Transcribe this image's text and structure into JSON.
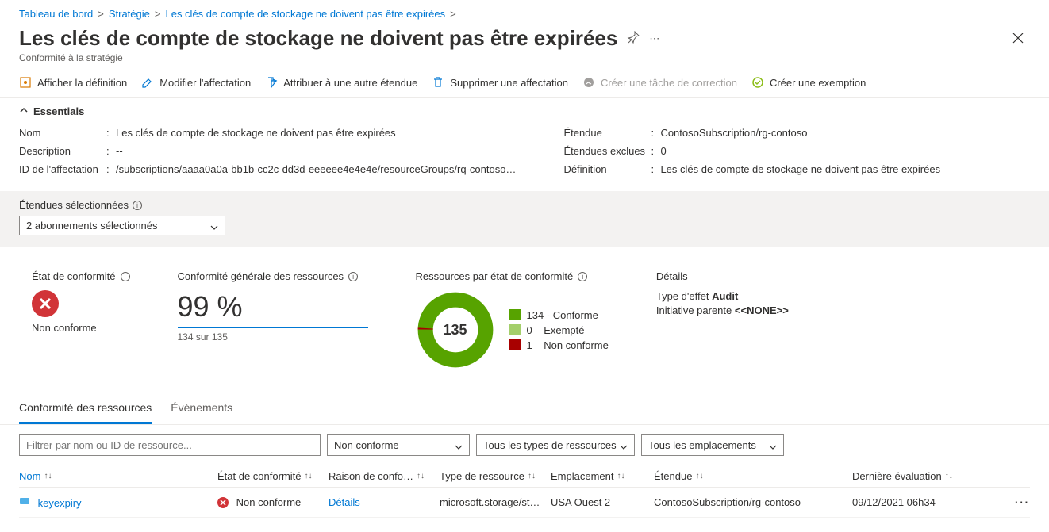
{
  "breadcrumb": {
    "items": [
      "Tableau de bord",
      "Stratégie",
      "Les clés de compte de stockage ne doivent pas être expirées"
    ],
    "sep": ">"
  },
  "header": {
    "title": "Les clés de compte de stockage ne doivent pas être expirées",
    "subtitle": "Conformité à la stratégie"
  },
  "toolbar": {
    "view_def": "Afficher la définition",
    "edit_assign": "Modifier l'affectation",
    "assign_scope": "Attribuer à une autre étendue",
    "delete_assign": "Supprimer une affectation",
    "create_task": "Créer une tâche de correction",
    "create_exemption": "Créer une exemption"
  },
  "essentials": {
    "header": "Essentials",
    "left": {
      "nom_label": "Nom",
      "nom_value": "Les clés de compte de stockage ne doivent pas être expirées",
      "desc_label": "Description",
      "desc_value": "--",
      "id_label": "ID de l'affectation",
      "id_value": "/subscriptions/aaaa0a0a-bb1b-cc2c-dd3d-eeeeee4e4e4e/resourceGroups/rq-contoso…"
    },
    "right": {
      "etendue_label": "Étendue",
      "etendue_value": "ContosoSubscription/rg-contoso",
      "exclues_label": "Étendues exclues",
      "exclues_value": "0",
      "def_label": "Définition",
      "def_value": "Les clés de compte de stockage ne doivent pas être expirées"
    }
  },
  "scope_bar": {
    "label": "Étendues sélectionnées",
    "value": "2 abonnements sélectionnés"
  },
  "stats": {
    "compliance_state": {
      "title": "État de conformité",
      "status": "Non conforme"
    },
    "overall": {
      "title": "Conformité générale des ressources",
      "pct": "99 %",
      "sub": "134 sur 135"
    },
    "by_state": {
      "title": "Ressources par état de conformité",
      "center": "135",
      "legend": [
        {
          "count": "134",
          "label": "Conforme",
          "color": "#57a300"
        },
        {
          "count": "0",
          "label": "Exempté",
          "color": "#a4cf6b"
        },
        {
          "count": "1",
          "label": "Non conforme",
          "color": "#a80000"
        }
      ]
    },
    "details": {
      "title": "Détails",
      "effect_label": "Type d'effet",
      "effect_value": "Audit",
      "parent_label": "Initiative parente",
      "parent_value": "<<NONE>>"
    }
  },
  "tabs": {
    "compliance": "Conformité des ressources",
    "events": "Événements"
  },
  "filters": {
    "name_placeholder": "Filtrer par nom ou ID de ressource...",
    "state": "Non conforme",
    "type": "Tous les types de ressources",
    "location": "Tous les emplacements"
  },
  "table": {
    "headers": {
      "nom": "Nom",
      "etat": "État de conformité",
      "raison": "Raison de confo…",
      "type": "Type de ressource",
      "emp": "Emplacement",
      "etendue": "Étendue",
      "eval": "Dernière évaluation"
    },
    "rows": [
      {
        "nom": "keyexpiry",
        "etat": "Non conforme",
        "raison": "Détails",
        "type": "microsoft.storage/st…",
        "emp": "USA Ouest 2",
        "etendue": "ContosoSubscription/rg-contoso",
        "eval": "09/12/2021 06h34"
      }
    ]
  }
}
